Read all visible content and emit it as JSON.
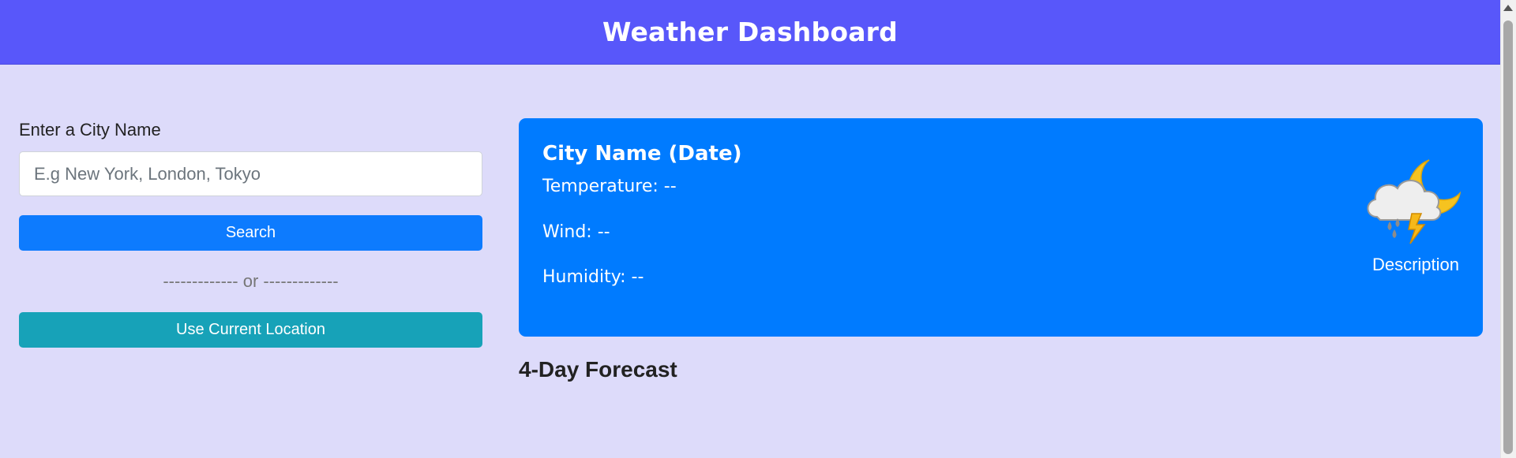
{
  "header": {
    "title": "Weather Dashboard"
  },
  "search": {
    "label": "Enter a City Name",
    "placeholder": "E.g New York, London, Tokyo",
    "value": "",
    "search_button": "Search",
    "divider": "------------- or -------------",
    "location_button": "Use Current Location"
  },
  "current": {
    "city": "City Name (Date)",
    "temperature": "Temperature: --",
    "wind": "Wind: --",
    "humidity": "Humidity: --",
    "description": "Description",
    "icon": "thunderstorm-night-icon"
  },
  "forecast": {
    "title": "4-Day Forecast"
  },
  "colors": {
    "header": "#5857fa",
    "background": "#dddbfa",
    "card": "#007bff",
    "search_button": "#0d7bfe",
    "location_button": "#17a2b8"
  }
}
